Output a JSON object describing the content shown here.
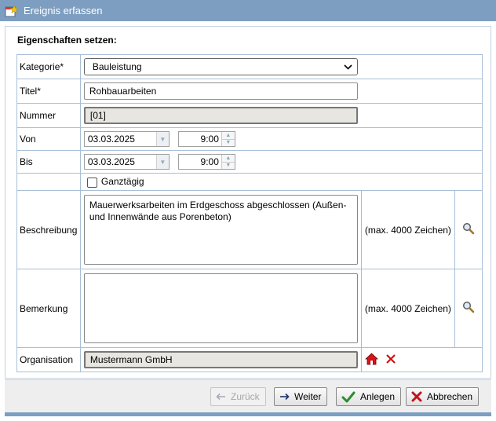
{
  "window": {
    "title": "Ereignis erfassen"
  },
  "section": {
    "title": "Eigenschaften setzen:"
  },
  "fields": {
    "kategorie": {
      "label": "Kategorie*",
      "value": "Bauleistung"
    },
    "titel": {
      "label": "Titel*",
      "value": "Rohbauarbeiten"
    },
    "nummer": {
      "label": "Nummer",
      "value": "[01]"
    },
    "von": {
      "label": "Von",
      "date": "03.03.2025",
      "time": "9:00"
    },
    "bis": {
      "label": "Bis",
      "date": "03.03.2025",
      "time": "9:00"
    },
    "ganztaegig": {
      "label": "Ganztägig",
      "checked": false
    },
    "beschreibung": {
      "label": "Beschreibung",
      "value": "Mauerwerksarbeiten im Erdgeschoss abgeschlossen (Außen- und Innenwände aus Porenbeton)",
      "hint": "(max. 4000 Zeichen)"
    },
    "bemerkung": {
      "label": "Bemerkung",
      "value": "",
      "hint": "(max. 4000 Zeichen)"
    },
    "organisation": {
      "label": "Organisation",
      "value": "Mustermann GmbH"
    }
  },
  "buttons": {
    "back": "Zurück",
    "next": "Weiter",
    "create": "Anlegen",
    "cancel": "Abbrechen"
  },
  "colors": {
    "titlebar": "#7d9ec0",
    "grid": "#a9bfd6",
    "ok_green": "#2e8b2e",
    "cancel_red": "#c0151b"
  }
}
